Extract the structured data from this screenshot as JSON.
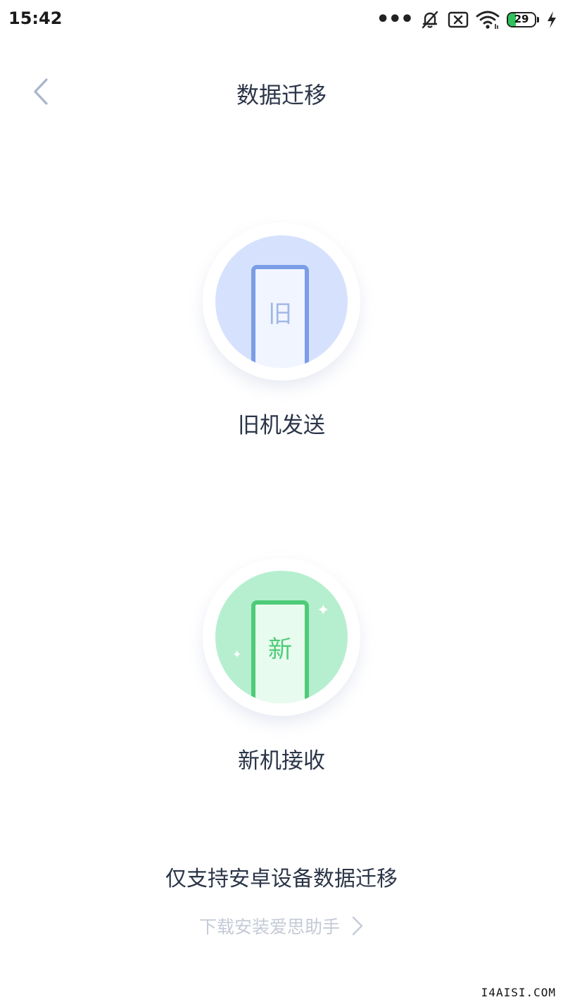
{
  "status_bar": {
    "time": "15:42",
    "battery_level": "29",
    "battery_fill_fraction": 0.29,
    "icons": [
      "more-dots-icon",
      "bell-muted-icon",
      "sim-x-icon",
      "wifi-icon",
      "battery-icon",
      "charging-icon"
    ]
  },
  "header": {
    "title": "数据迁移",
    "back_icon": "chevron-left-icon"
  },
  "options": {
    "old": {
      "phone_char": "旧",
      "label": "旧机发送",
      "accent": "#7b9de6",
      "bg": "#d6e2fd"
    },
    "new": {
      "phone_char": "新",
      "label": "新机接收",
      "accent": "#4fcb78",
      "bg": "#b6efcf"
    }
  },
  "footer": {
    "note": "仅支持安卓设备数据迁移",
    "download_link": "下载安装爱思助手",
    "download_icon": "chevron-right-icon"
  },
  "watermark": "I4AISI.COM"
}
